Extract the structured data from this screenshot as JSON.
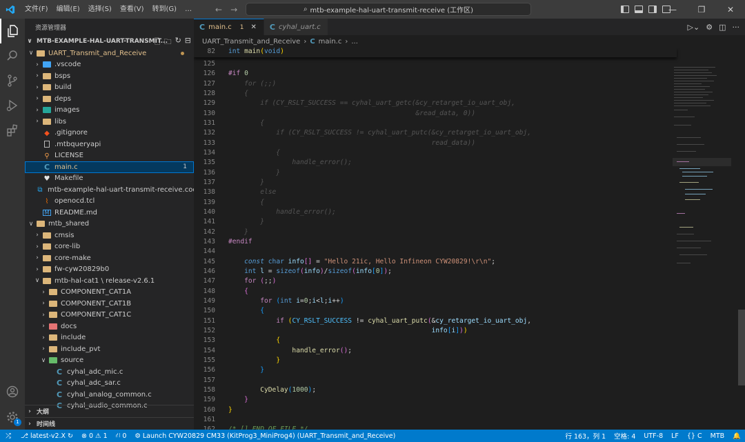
{
  "menu": [
    "文件(F)",
    "编辑(E)",
    "选择(S)",
    "查看(V)",
    "转到(G)",
    "…"
  ],
  "command_center": "mtb-example-hal-uart-transmit-receive (工作区)",
  "window_controls": {
    "minimize": "—",
    "restore": "❐",
    "close": "✕"
  },
  "activity_badge": "1",
  "sidebar": {
    "title": "资源管理器",
    "workspace": "MTB-EXAMPLE-HAL-UART-TRANSMIT...",
    "items": [
      {
        "label": "UART_Transmit_and_Receive",
        "indent": 1,
        "chev": "∨",
        "icon": "folder"
      },
      {
        "label": ".vscode",
        "indent": 2,
        "chev": "›",
        "icon": "folder-blue"
      },
      {
        "label": "bsps",
        "indent": 2,
        "chev": "›",
        "icon": "folder"
      },
      {
        "label": "build",
        "indent": 2,
        "chev": "›",
        "icon": "folder"
      },
      {
        "label": "deps",
        "indent": 2,
        "chev": "›",
        "icon": "folder"
      },
      {
        "label": "images",
        "indent": 2,
        "chev": "›",
        "icon": "folder-teal"
      },
      {
        "label": "libs",
        "indent": 2,
        "chev": "›",
        "icon": "folder"
      },
      {
        "label": ".gitignore",
        "indent": 2,
        "chev": "",
        "icon": "git"
      },
      {
        "label": ".mtbqueryapi",
        "indent": 2,
        "chev": "",
        "icon": "file"
      },
      {
        "label": "LICENSE",
        "indent": 2,
        "chev": "",
        "icon": "license"
      },
      {
        "label": "main.c",
        "indent": 2,
        "chev": "",
        "icon": "c",
        "badge": "1"
      },
      {
        "label": "Makefile",
        "indent": 2,
        "chev": "",
        "icon": "make"
      },
      {
        "label": "mtb-example-hal-uart-transmit-receive.cod...",
        "indent": 2,
        "chev": "",
        "icon": "vscode"
      },
      {
        "label": "openocd.tcl",
        "indent": 2,
        "chev": "",
        "icon": "tcl"
      },
      {
        "label": "README.md",
        "indent": 2,
        "chev": "",
        "icon": "md"
      },
      {
        "label": "mtb_shared",
        "indent": 1,
        "chev": "∨",
        "icon": "folder"
      },
      {
        "label": "cmsis",
        "indent": 2,
        "chev": "›",
        "icon": "folder"
      },
      {
        "label": "core-lib",
        "indent": 2,
        "chev": "›",
        "icon": "folder"
      },
      {
        "label": "core-make",
        "indent": 2,
        "chev": "›",
        "icon": "folder"
      },
      {
        "label": "fw-cyw20829b0",
        "indent": 2,
        "chev": "›",
        "icon": "folder"
      },
      {
        "label": "mtb-hal-cat1 \\ release-v2.6.1",
        "indent": 2,
        "chev": "∨",
        "icon": "folder"
      },
      {
        "label": "COMPONENT_CAT1A",
        "indent": 3,
        "chev": "›",
        "icon": "folder"
      },
      {
        "label": "COMPONENT_CAT1B",
        "indent": 3,
        "chev": "›",
        "icon": "folder"
      },
      {
        "label": "COMPONENT_CAT1C",
        "indent": 3,
        "chev": "›",
        "icon": "folder"
      },
      {
        "label": "docs",
        "indent": 3,
        "chev": "›",
        "icon": "folder-red"
      },
      {
        "label": "include",
        "indent": 3,
        "chev": "›",
        "icon": "folder"
      },
      {
        "label": "include_pvt",
        "indent": 3,
        "chev": "›",
        "icon": "folder"
      },
      {
        "label": "source",
        "indent": 3,
        "chev": "∨",
        "icon": "folder-green"
      },
      {
        "label": "cyhal_adc_mic.c",
        "indent": 4,
        "chev": "",
        "icon": "c"
      },
      {
        "label": "cyhal_adc_sar.c",
        "indent": 4,
        "chev": "",
        "icon": "c"
      },
      {
        "label": "cyhal_analog_common.c",
        "indent": 4,
        "chev": "",
        "icon": "c"
      },
      {
        "label": "cyhal_audio_common.c",
        "indent": 4,
        "chev": "",
        "icon": "c"
      }
    ],
    "outline": "大纲",
    "timeline": "时间线"
  },
  "tabs": [
    {
      "label": "main.c",
      "badge": "1",
      "close": "✕"
    },
    {
      "label": "cyhal_uart.c"
    }
  ],
  "breadcrumb": {
    "folder": "UART_Transmit_and_Receive",
    "sep": "›",
    "file": "main.c",
    "more": "..."
  },
  "sticky": {
    "ln": "82",
    "code": "int main(void)"
  },
  "statusbar": {
    "branch": "latest-v2.X",
    "problems": "0 ⚠ 1",
    "ports": "0",
    "launch": "Launch CYW20829 CM33 (KitProg3_MiniProg4) (UART_Transmit_and_Receive)",
    "position": "行 163，列 1",
    "spaces": "空格: 4",
    "encoding": "UTF-8",
    "eol": "LF",
    "language": "C",
    "config": "MTB"
  }
}
